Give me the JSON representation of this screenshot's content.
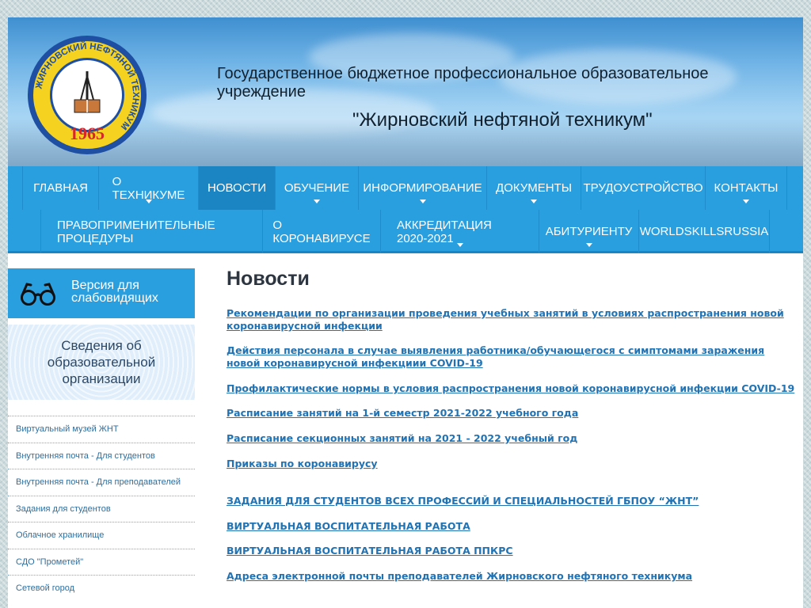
{
  "header": {
    "logo": {
      "top_text": "ЖИРНОВСКИЙ НЕФТЯНОЙ ТЕХНИКУМ",
      "year": "1965"
    },
    "org_line1": "Государственное бюджетное профессиональное образовательное учреждение",
    "org_line2": "\"Жирновский нефтяной техникум\""
  },
  "nav": {
    "row1": [
      {
        "label": "ГЛАВНАЯ",
        "has_submenu": false,
        "active": false
      },
      {
        "label": "О ТЕХНИКУМЕ",
        "has_submenu": true,
        "active": false
      },
      {
        "label": "НОВОСТИ",
        "has_submenu": false,
        "active": true
      },
      {
        "label": "ОБУЧЕНИЕ",
        "has_submenu": true,
        "active": false
      },
      {
        "label": "ИНФОРМИРОВАНИЕ",
        "has_submenu": true,
        "active": false
      },
      {
        "label": "ДОКУМЕНТЫ",
        "has_submenu": true,
        "active": false
      },
      {
        "label": "ТРУДОУСТРОЙСТВО",
        "has_submenu": false,
        "active": false
      },
      {
        "label": "КОНТАКТЫ",
        "has_submenu": true,
        "active": false
      }
    ],
    "row2": [
      {
        "label": "ПРАВОПРИМЕНИТЕЛЬНЫЕ ПРОЦЕДУРЫ",
        "has_submenu": false,
        "active": false
      },
      {
        "label": "О КОРОНАВИРУСЕ",
        "has_submenu": false,
        "active": false
      },
      {
        "label": "АККРЕДИТАЦИЯ 2020-2021",
        "has_submenu": true,
        "active": false
      },
      {
        "label": "АБИТУРИЕНТУ",
        "has_submenu": true,
        "active": false
      },
      {
        "label": "WORLDSKILLSRUSSIA",
        "has_submenu": false,
        "active": false
      }
    ]
  },
  "sidebar": {
    "vision_button": {
      "label": "Версия для слабовидящих",
      "icon": "glasses-icon"
    },
    "info_card": {
      "label": "Сведения об образовательной организации"
    },
    "menu": [
      "Виртуальный музей ЖНТ",
      "Внутренняя почта - Для студентов",
      "Внутренняя почта - Для преподавателей",
      "Задания для студентов",
      "Облачное хранилище",
      "СДО \"Прометей\"",
      "Сетевой город"
    ]
  },
  "main": {
    "title": "Новости",
    "links": [
      "Рекомендации по организации проведения учебных занятий в условиях распространения новой коронавирусной инфекции",
      "Действия персонала в случае выявления работника/обучающегося с симптомами заражения новой коронавирусной инфекциии COVID-19",
      "Профилактические нормы в условия распространения новой коронавирусной инфекции COVID-19",
      "Расписание занятий на 1-й семестр 2021-2022 учебного года",
      "Расписание секционных занятий на 2021 - 2022 учебный год",
      "Приказы по коронавирусу",
      "ЗАДАНИЯ ДЛЯ СТУДЕНТОВ ВСЕХ ПРОФЕССИЙ И СПЕЦИАЛЬНОСТЕЙ ГБПОУ “ЖНТ”",
      "ВИРТУАЛЬНАЯ ВОСПИТАТЕЛЬНАЯ РАБОТА",
      "ВИРТУАЛЬНАЯ ВОСПИТАТЕЛЬНАЯ РАБОТА ППКРС",
      "Адреса электронной почты преподавателей Жирновского нефтяного техникума"
    ]
  },
  "colors": {
    "nav_bg": "#2a9fe0",
    "nav_active": "#1b84c2",
    "link": "#2173b4",
    "logo_ring_blue": "#1e4fa3",
    "logo_ring_yellow": "#f4d21f",
    "logo_year_red": "#d8252a"
  }
}
